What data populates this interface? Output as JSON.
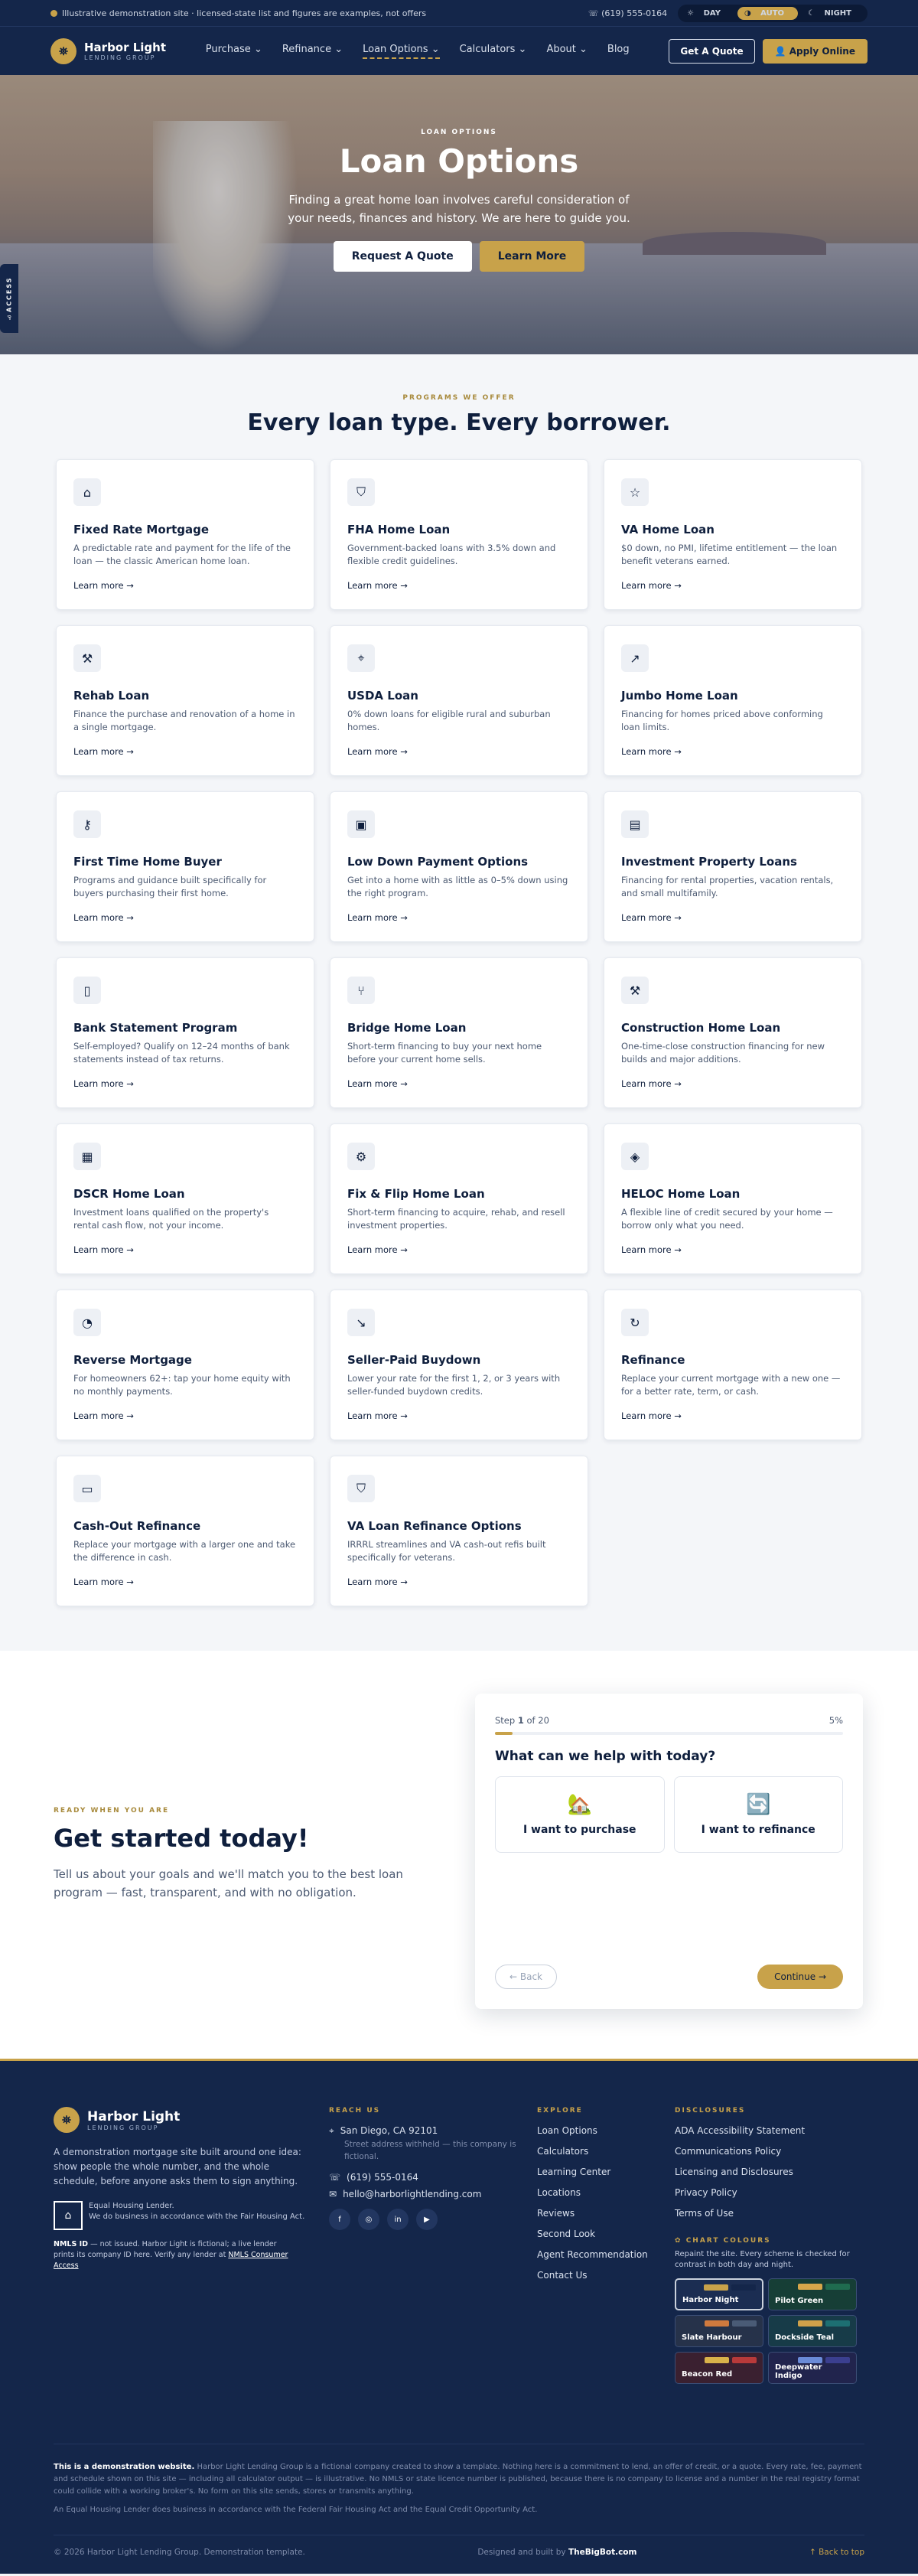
{
  "topbar": {
    "notice": "Illustrative demonstration site · licensed-state list and figures are examples, not offers",
    "phone": "(619) 555-0164",
    "modes": [
      "DAY",
      "AUTO",
      "NIGHT"
    ],
    "active_mode": "AUTO"
  },
  "nav": {
    "brand": "Harbor Light",
    "brand_sub": "LENDING GROUP",
    "items": [
      "Purchase",
      "Refinance",
      "Loan Options",
      "Calculators",
      "About",
      "Blog"
    ],
    "quote_label": "Get A Quote",
    "apply_label": "Apply Online"
  },
  "hero": {
    "eyebrow": "LOAN OPTIONS",
    "title": "Loan Options",
    "subtitle": "Finding a great home loan involves careful consideration of your needs, finances and history. We are here to guide you.",
    "cta_primary": "Request A Quote",
    "cta_secondary": "Learn More"
  },
  "access_tab": "ACCESS",
  "programs": {
    "eyebrow": "PROGRAMS WE OFFER",
    "title": "Every loan type. Every borrower.",
    "learn_more": "Learn more →",
    "cards": [
      {
        "icon": "home-icon",
        "glyph": "⌂",
        "title": "Fixed Rate Mortgage",
        "desc": "A predictable rate and payment for the life of the loan — the classic American home loan."
      },
      {
        "icon": "shield-icon",
        "glyph": "⛉",
        "title": "FHA Home Loan",
        "desc": "Government-backed loans with 3.5% down and flexible credit guidelines."
      },
      {
        "icon": "star-icon",
        "glyph": "☆",
        "title": "VA Home Loan",
        "desc": "$0 down, no PMI, lifetime entitlement — the loan benefit veterans earned."
      },
      {
        "icon": "hammer-icon",
        "glyph": "⚒",
        "title": "Rehab Loan",
        "desc": "Finance the purchase and renovation of a home in a single mortgage."
      },
      {
        "icon": "map-pin-icon",
        "glyph": "⌖",
        "title": "USDA Loan",
        "desc": "0% down loans for eligible rural and suburban homes."
      },
      {
        "icon": "trend-up-icon",
        "glyph": "↗",
        "title": "Jumbo Home Loan",
        "desc": "Financing for homes priced above conforming loan limits."
      },
      {
        "icon": "key-icon",
        "glyph": "⚷",
        "title": "First Time Home Buyer",
        "desc": "Programs and guidance built specifically for buyers purchasing their first home."
      },
      {
        "icon": "wallet-icon",
        "glyph": "▣",
        "title": "Low Down Payment Options",
        "desc": "Get into a home with as little as 0–5% down using the right program."
      },
      {
        "icon": "building-icon",
        "glyph": "▤",
        "title": "Investment Property Loans",
        "desc": "Financing for rental properties, vacation rentals, and small multifamily."
      },
      {
        "icon": "document-icon",
        "glyph": "▯",
        "title": "Bank Statement Program",
        "desc": "Self-employed? Qualify on 12–24 months of bank statements instead of tax returns."
      },
      {
        "icon": "branch-icon",
        "glyph": "⑂",
        "title": "Bridge Home Loan",
        "desc": "Short-term financing to buy your next home before your current home sells."
      },
      {
        "icon": "hammer-icon",
        "glyph": "⚒",
        "title": "Construction Home Loan",
        "desc": "One-time-close construction financing for new builds and major additions."
      },
      {
        "icon": "calculator-icon",
        "glyph": "▦",
        "title": "DSCR Home Loan",
        "desc": "Investment loans qualified on the property's rental cash flow, not your income."
      },
      {
        "icon": "wrench-icon",
        "glyph": "⚙",
        "title": "Fix & Flip Home Loan",
        "desc": "Short-term financing to acquire, rehab, and resell investment properties."
      },
      {
        "icon": "layers-icon",
        "glyph": "◈",
        "title": "HELOC Home Loan",
        "desc": "A flexible line of credit secured by your home — borrow only what you need."
      },
      {
        "icon": "piggy-bank-icon",
        "glyph": "◔",
        "title": "Reverse Mortgage",
        "desc": "For homeowners 62+: tap your home equity with no monthly payments."
      },
      {
        "icon": "trend-down-icon",
        "glyph": "↘",
        "title": "Seller-Paid Buydown",
        "desc": "Lower your rate for the first 1, 2, or 3 years with seller-funded buydown credits."
      },
      {
        "icon": "refresh-icon",
        "glyph": "↻",
        "title": "Refinance",
        "desc": "Replace your current mortgage with a new one — for a better rate, term, or cash."
      },
      {
        "icon": "cash-icon",
        "glyph": "▭",
        "title": "Cash-Out Refinance",
        "desc": "Replace your mortgage with a larger one and take the difference in cash."
      },
      {
        "icon": "shield-check-icon",
        "glyph": "⛉",
        "title": "VA Loan Refinance Options",
        "desc": "IRRRL streamlines and VA cash-out refis built specifically for veterans."
      }
    ]
  },
  "start": {
    "eyebrow": "READY WHEN YOU ARE",
    "title": "Get started today!",
    "desc": "Tell us about your goals and we'll match you to the best loan program — fast, transparent, and with no obligation."
  },
  "quiz": {
    "step_prefix": "Step",
    "step_current": "1",
    "step_suffix": "of 20",
    "percent": "5%",
    "progress": 0.05,
    "question": "What can we help with today?",
    "options": [
      {
        "emoji": "🏡",
        "label": "I want to purchase"
      },
      {
        "emoji": "🔄",
        "label": "I want to refinance"
      }
    ],
    "back_label": "← Back",
    "continue_label": "Continue →"
  },
  "footer": {
    "brand": "Harbor Light",
    "brand_sub": "LENDING GROUP",
    "desc": "A demonstration mortgage site built around one idea: show people the whole number, and the whole schedule, before anyone asks them to sign anything.",
    "eho_line1": "Equal Housing Lender.",
    "eho_line2": "We do business in accordance with the Fair Housing Act.",
    "nmls_label": "NMLS ID",
    "nmls_text": "— not issued. Harbor Light is fictional; a live lender prints its company ID here. Verify any lender at",
    "nmls_link": "NMLS Consumer Access",
    "reach_title": "REACH US",
    "address": "San Diego, CA 92101",
    "address_note": "Street address withheld — this company is fictional.",
    "phone": "(619) 555-0164",
    "email": "hello@harborlightlending.com",
    "socials": [
      "f",
      "◎",
      "in",
      "▶"
    ],
    "explore_title": "EXPLORE",
    "explore": [
      "Loan Options",
      "Calculators",
      "Learning Center",
      "Locations",
      "Reviews",
      "Second Look",
      "Agent Recommendation",
      "Contact Us"
    ],
    "disc_title": "DISCLOSURES",
    "disclosures": [
      "ADA Accessibility Statement",
      "Communications Policy",
      "Licensing and Disclosures",
      "Privacy Policy",
      "Terms of Use"
    ],
    "chart_title": "CHART COLOURS",
    "chart_sub": "Repaint the site. Every scheme is checked for contrast in both day and night.",
    "schemes": [
      {
        "name": "Harbor Night",
        "c1": "#c8a24a",
        "c2": "#14264a",
        "bg": "#1b2d52"
      },
      {
        "name": "Pilot Green",
        "c1": "#d6a64a",
        "c2": "#1f6b4f",
        "bg": "#163e36"
      },
      {
        "name": "Slate Harbour",
        "c1": "#d07a3e",
        "c2": "#4a5b76",
        "bg": "#26324a"
      },
      {
        "name": "Dockside Teal",
        "c1": "#d0a14a",
        "c2": "#1d6f72",
        "bg": "#173b48"
      },
      {
        "name": "Beacon Red",
        "c1": "#d9b24a",
        "c2": "#b83a3a",
        "bg": "#3a2030"
      },
      {
        "name": "Deepwater Indigo",
        "c1": "#6a8bd8",
        "c2": "#3b3f8f",
        "bg": "#21244d"
      }
    ],
    "demo_label": "This is a demonstration website.",
    "demo_text": "Harbor Light Lending Group is a fictional company created to show a template. Nothing here is a commitment to lend, an offer of credit, or a quote. Every rate, fee, payment and schedule shown on this site — including all calculator output — is illustrative. No NMLS or state licence number is published, because there is no company to license and a number in the real registry format could collide with a working broker's. No form on this site sends, stores or transmits anything.",
    "eq_text": "An Equal Housing Lender does business in accordance with the Federal Fair Housing Act and the Equal Credit Opportunity Act.",
    "copyright": "© 2026 Harbor Light Lending Group. Demonstration template.",
    "built_prefix": "Designed and built by",
    "built_by": "TheBigBot.com",
    "back_top": "↑ Back to top"
  }
}
